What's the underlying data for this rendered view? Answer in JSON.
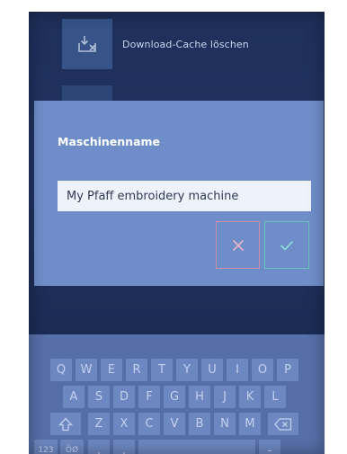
{
  "background": {
    "menu_item_label": "Download-Cache löschen",
    "menu_item_icon": "download-clear-icon"
  },
  "dialog": {
    "title": "Maschinenname",
    "name_value": "My Pfaff embroidery machine",
    "cancel_icon": "close-icon",
    "confirm_icon": "check-icon"
  },
  "keyboard": {
    "row1": [
      "Q",
      "W",
      "E",
      "R",
      "T",
      "Y",
      "U",
      "I",
      "O",
      "P"
    ],
    "row2": [
      "A",
      "S",
      "D",
      "F",
      "G",
      "H",
      "J",
      "K",
      "L"
    ],
    "row3": [
      "Z",
      "X",
      "C",
      "V",
      "B",
      "N",
      "M"
    ],
    "shift_icon": "shift-icon",
    "backspace_icon": "backspace-icon",
    "numbers_label": "123",
    "umlaut_label": "ÖØ",
    "comma_label": ",",
    "period_label": ".",
    "dash_label": "-"
  },
  "colors": {
    "screen_bg": "#1e2f5a",
    "dialog_bg": "#6f8ec9",
    "input_bg": "#eef2fb",
    "cancel_accent": "#c98fa9",
    "confirm_accent": "#67c4ba",
    "keyboard_bg": "#566fa8",
    "key_bg": "#6d87c0"
  }
}
